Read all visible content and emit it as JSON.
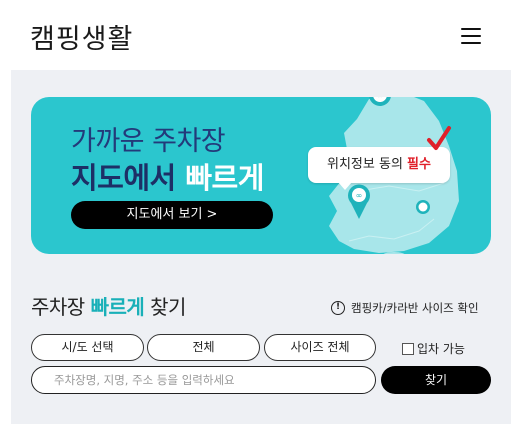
{
  "header": {
    "logo": "캠핑생활",
    "menu_icon": "hamburger-menu-icon"
  },
  "banner": {
    "line1": "가까운 주차장",
    "line2_prefix": "지도에서 ",
    "line2_highlight": "빠르게",
    "button_label": "지도에서 보기 >",
    "bubble_text": "위치정보 동의 ",
    "bubble_required": "필수",
    "map_color": "#a8e6ea",
    "bg_color": "#2bc6ce"
  },
  "search": {
    "title_prefix": "주차장 ",
    "title_highlight": "빠르게",
    "title_suffix": " 찾기",
    "size_check_label": "캠핑카/카라반 사이즈 확인",
    "region_select": "시/도 선택",
    "district_select": "전체",
    "size_select": "사이즈 전체",
    "entry_checkbox_label": "입차 가능",
    "input_placeholder": "주차장명, 지명, 주소 등을 입력하세요",
    "search_button": "찾기"
  }
}
